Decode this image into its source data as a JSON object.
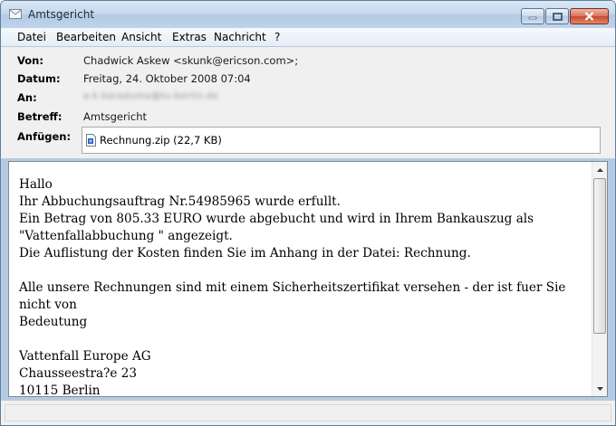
{
  "window": {
    "title": "Amtsgericht"
  },
  "menu": [
    "Datei",
    "Bearbeiten",
    "Ansicht",
    "Extras",
    "Nachricht",
    "?"
  ],
  "headers": {
    "from_label": "Von:",
    "from_value": "Chadwick Askew <skunk@ericson.com>;",
    "date_label": "Datum:",
    "date_value": "Freitag, 24. Oktober 2008 07:04",
    "to_label": "An:",
    "to_value_redacted": "a.k.karaduma@tu-berlin.de",
    "subject_label": "Betreff:",
    "subject_value": "Amtsgericht",
    "attach_label": "Anfügen:",
    "attachment": "Rechnung.zip (22,7 KB)"
  },
  "message": {
    "body": "Hallo\nIhr Abbuchungsauftrag Nr.54985965 wurde erfullt.\nEin Betrag von 805.33 EURO wurde abgebucht und wird in Ihrem Bankauszug als\n\"Vattenfallabbuchung \" angezeigt.\nDie Auflistung der Kosten finden Sie im Anhang in der Datei: Rechnung.\n\nAlle unsere Rechnungen sind mit einem Sicherheitszertifikat versehen - der ist fuer Sie nicht von\nBedeutung\n\nVattenfall Europe AG\nChausseestra?e 23\n10115 Berlin"
  },
  "icons": {
    "title": "envelope-icon",
    "attachment": "zip-file-icon",
    "minimize": "minimize-icon",
    "maximize": "maximize-icon",
    "close": "close-icon",
    "scroll_up": "arrow-up-icon",
    "scroll_down": "arrow-down-icon"
  }
}
